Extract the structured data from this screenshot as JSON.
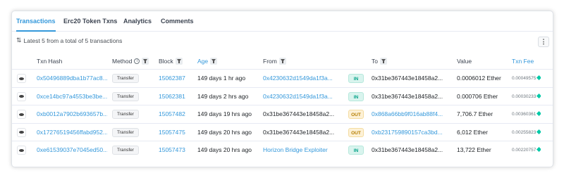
{
  "tabs": [
    {
      "label": "Transactions",
      "active": true
    },
    {
      "label": "Erc20 Token Txns",
      "active": false
    },
    {
      "label": "Analytics",
      "active": false
    },
    {
      "label": "Comments",
      "active": false
    }
  ],
  "summary": "Latest 5 from a total of 5 transactions",
  "menu_label": "⋮",
  "columns": {
    "txn_hash": "Txn Hash",
    "method": "Method",
    "block": "Block",
    "age": "Age",
    "from": "From",
    "to": "To",
    "value": "Value",
    "txn_fee": "Txn Fee"
  },
  "colors": {
    "accent": "#3498db",
    "in": "#00a186",
    "out": "#b47d00"
  },
  "rows": [
    {
      "hash": "0x50496889dba1b77ac8...",
      "method": "Transfer",
      "block": "15062387",
      "age": "149 days 1 hr ago",
      "from": "0x4230632d1549da1f3a...",
      "from_link": true,
      "direction": "IN",
      "to": "0x31be367443e18458a2...",
      "to_link": false,
      "value": "0.0006012 Ether",
      "fee": "0.00049575"
    },
    {
      "hash": "0xce14bc97a4553be3be...",
      "method": "Transfer",
      "block": "15062381",
      "age": "149 days 2 hrs ago",
      "from": "0x4230632d1549da1f3a...",
      "from_link": true,
      "direction": "IN",
      "to": "0x31be367443e18458a2...",
      "to_link": false,
      "value": "0.000706 Ether",
      "fee": "0.00030233"
    },
    {
      "hash": "0xb0012a7902b693657b...",
      "method": "Transfer",
      "block": "15057482",
      "age": "149 days 19 hrs ago",
      "from": "0x31be367443e18458a2...",
      "from_link": false,
      "direction": "OUT",
      "to": "0x868a66bb9f016ab88f4...",
      "to_link": true,
      "value": "7,706.7 Ether",
      "fee": "0.00360361"
    },
    {
      "hash": "0x17276519456ffabd952...",
      "method": "Transfer",
      "block": "15057475",
      "age": "149 days 20 hrs ago",
      "from": "0x31be367443e18458a2...",
      "from_link": false,
      "direction": "OUT",
      "to": "0xb231759890157ca3bd...",
      "to_link": true,
      "value": "6,012 Ether",
      "fee": "0.00255823"
    },
    {
      "hash": "0xe61539037e7045ed50...",
      "method": "Transfer",
      "block": "15057473",
      "age": "149 days 20 hrs ago",
      "from": "Horizon Bridge Exploiter",
      "from_link": true,
      "direction": "IN",
      "to": "0x31be367443e18458a2...",
      "to_link": false,
      "value": "13,722 Ether",
      "fee": "0.00220757"
    }
  ]
}
